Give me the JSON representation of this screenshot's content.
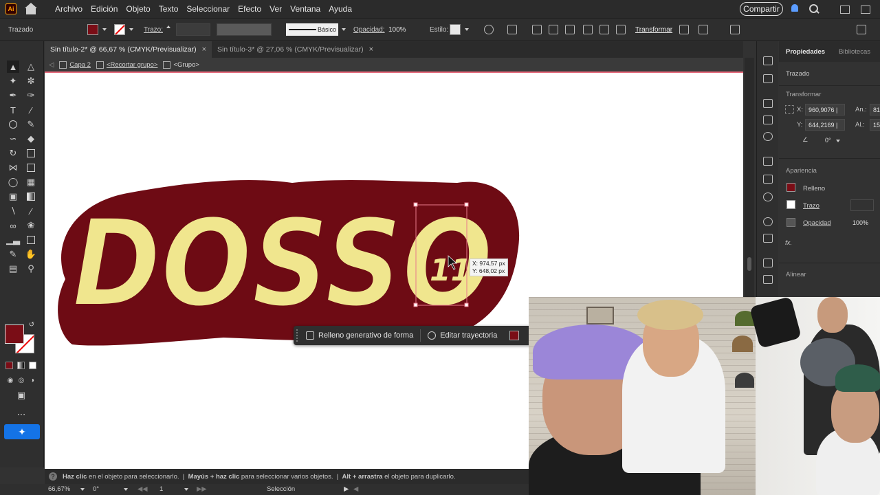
{
  "app": {
    "logo_text": "Ai"
  },
  "menu": [
    "Archivo",
    "Edición",
    "Objeto",
    "Texto",
    "Seleccionar",
    "Efecto",
    "Ver",
    "Ventana",
    "Ayuda"
  ],
  "share_label": "Compartir",
  "control": {
    "mode_label": "Trazado",
    "stroke_label": "Trazo:",
    "stroke_style": "Básico",
    "opacity_label": "Opacidad:",
    "opacity_value": "100%",
    "style_label": "Estilo:",
    "transform_label": "Transformar",
    "fill_color": "#7a0d16"
  },
  "tabs": [
    {
      "label": "Sin título-2* @ 66,67 % (CMYK/Previsualizar)",
      "close": "×"
    },
    {
      "label": "Sin título-3* @ 27,06 % (CMYK/Previsualizar)",
      "close": "×"
    }
  ],
  "breadcrumb": {
    "layer": "Capa 2",
    "clip_group": "<Recortar grupo>",
    "group": "<Grupo>"
  },
  "artwork": {
    "text": "DOSSO",
    "badge": "11",
    "fill_color": "#f0e68e",
    "outline_color": "#6e0b14"
  },
  "cursor_readout": {
    "x": "X: 974,57 px",
    "y": "Y: 648,02 px"
  },
  "context_bar": {
    "generative_fill": "Relleno generativo de forma",
    "edit_path": "Editar trayectoria"
  },
  "properties": {
    "tabs": [
      "Propiedades",
      "Bibliotecas"
    ],
    "object_type": "Trazado",
    "transform_head": "Transformar",
    "x_label": "X:",
    "x_value": "960,9076 |",
    "y_label": "Y:",
    "y_value": "644,2169 |",
    "w_label": "An.:",
    "w_value": "81",
    "h_label": "Al.:",
    "h_value": "15",
    "angle_value": "0°",
    "appearance_head": "Apariencia",
    "fill_label": "Relleno",
    "stroke_label": "Trazo",
    "opacity_label": "Opacidad",
    "opacity_value": "100%",
    "fx_label": "fx.",
    "align_head": "Alinear"
  },
  "status": {
    "help": "?",
    "click": "Haz clic",
    "click_text": " en el objeto para seleccionarlo.  |  ",
    "shift_click": "Mayús + haz clic",
    "shift_text": " para seleccionar varios objetos.  |  ",
    "alt_drag": "Alt + arrastra",
    "alt_text": " el objeto para duplicarlo."
  },
  "bottom": {
    "zoom": "66,67%",
    "rotation": "0°",
    "artboard": "1",
    "tool": "Selección"
  }
}
